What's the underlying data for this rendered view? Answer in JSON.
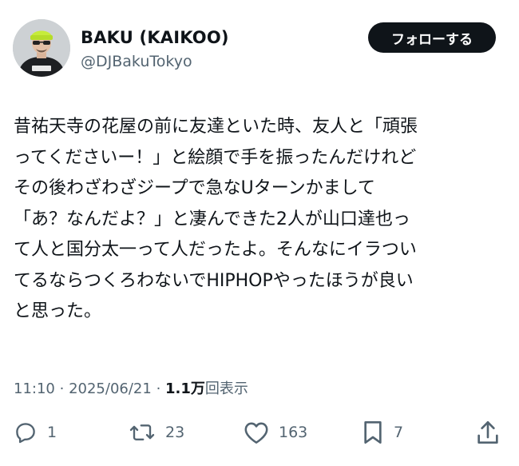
{
  "author": {
    "display_name": "BAKU (KAIKOO)",
    "handle": "@DJBakuTokyo",
    "avatar_icon": "user-avatar"
  },
  "follow_button": {
    "label": "フォローする"
  },
  "tweet": {
    "lines": [
      "昔祐天寺の花屋の前に友達といた時、友人と「頑張",
      "ってくださいー！」と絵顔で手を振ったんだけれど",
      "その後わざわざジープで急なUターンかまして",
      "「あ？なんだよ？」と凄んできた2人が山口達也っ",
      "て人と国分太一って人だったよ。そんなにイラつい",
      "てるならつくろわないでHIPHOPやったほうが良い",
      "と思った。"
    ]
  },
  "meta": {
    "time": "11:10",
    "separator": "·",
    "date": "2025/06/21",
    "views_count": "1.1万",
    "views_label": "回表示"
  },
  "actions": {
    "reply": {
      "icon": "reply-icon",
      "count": "1"
    },
    "retweet": {
      "icon": "retweet-icon",
      "count": "23"
    },
    "like": {
      "icon": "heart-icon",
      "count": "163"
    },
    "bookmark": {
      "icon": "bookmark-icon",
      "count": "7"
    },
    "share": {
      "icon": "share-icon"
    }
  },
  "colors": {
    "text_primary": "#0f1419",
    "text_secondary": "#536471",
    "follow_bg": "#0f1419",
    "follow_text": "#ffffff",
    "background": "#ffffff",
    "avatar_beanie": "#c6ec3b"
  }
}
